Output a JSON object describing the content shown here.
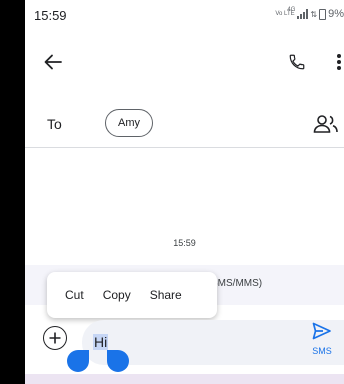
{
  "status_bar": {
    "time": "15:59",
    "network_badge": "Vo LTE",
    "network_type": "4G",
    "battery_percent": "9%",
    "icons": [
      "volte-icon",
      "signal-icon",
      "battery-icon"
    ]
  },
  "app_bar": {
    "icons": [
      "back-arrow-icon",
      "phone-icon",
      "more-vert-icon"
    ]
  },
  "recipients": {
    "to_label": "To",
    "contact_chip": "Amy",
    "icons": [
      "add-contacts-icon"
    ]
  },
  "conversation": {
    "timestamp": "15:59",
    "message_type_hint": "SMS/MMS)"
  },
  "context_menu": {
    "items": [
      "Cut",
      "Copy",
      "Share"
    ]
  },
  "compose": {
    "text": "Hi",
    "send_label": "SMS",
    "icons": [
      "add-circle-icon",
      "send-icon"
    ]
  },
  "colors": {
    "accent": "#1a73e8",
    "selection": "#c6d6f5",
    "compose_bg": "#f0f2f7",
    "sms_strip_bg": "#f4f4fa"
  }
}
